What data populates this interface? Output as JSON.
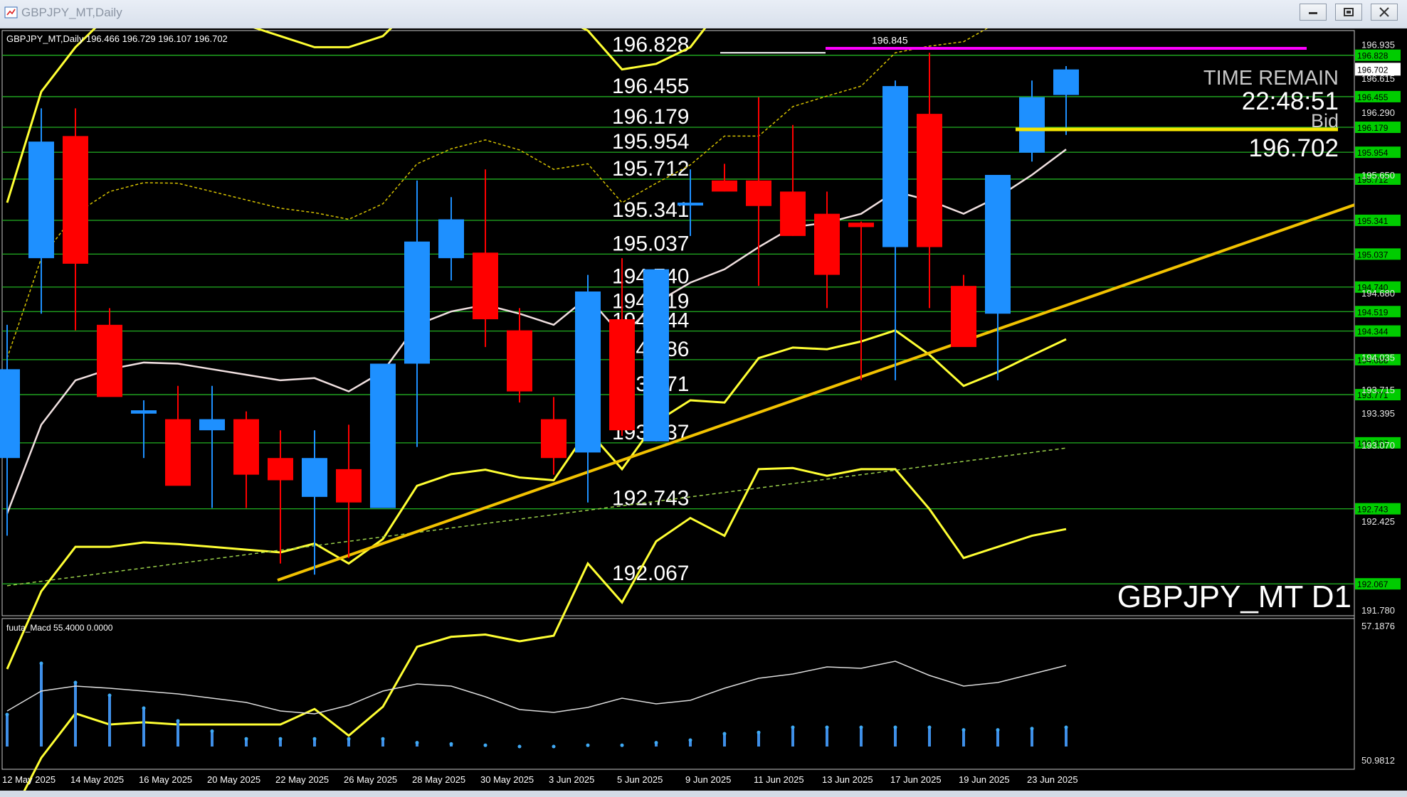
{
  "window": {
    "title": "GBPJPY_MT,Daily"
  },
  "chart_info": {
    "header": "GBPJPY_MT,Daily  196.466 196.729 196.107 196.702",
    "symbol_label": "GBPJPY_MT D1",
    "time_remain_label": "TIME REMAIN",
    "time_remain_value": "22:48:51",
    "bid_label": "Bid",
    "bid_value": "196.702",
    "high_marker": "196.845",
    "indicator_label": "fuuta_Macd 55.4000  0.0000",
    "indicator_top": "57.1876",
    "indicator_bottom": "50.9812"
  },
  "levels": [
    "196.828",
    "196.455",
    "196.179",
    "195.954",
    "195.712",
    "195.341",
    "195.037",
    "194.740",
    "194.519",
    "194.344",
    "194.086",
    "193.771",
    "193.337",
    "192.743",
    "192.067"
  ],
  "price_scale": [
    "196.935",
    "196.615",
    "196.290",
    "195.650",
    "194.680",
    "194.035",
    "193.715",
    "193.395",
    "193.070",
    "192.425",
    "191.780"
  ],
  "current_price_tag": "196.702",
  "x_axis": [
    "12 May 2025",
    "14 May 2025",
    "16 May 2025",
    "20 May 2025",
    "22 May 2025",
    "26 May 2025",
    "28 May 2025",
    "30 May 2025",
    "3 Jun 2025",
    "5 Jun 2025",
    "9 Jun 2025",
    "11 Jun 2025",
    "13 Jun 2025",
    "17 Jun 2025",
    "19 Jun 2025",
    "23 Jun 2025"
  ],
  "colors": {
    "background": "#000000",
    "bull": "#1e90ff",
    "bear": "#ff0000",
    "level_line": "#22b022",
    "level_tag": "#00cc00",
    "bands": "#ffff33",
    "trendline": "#f2c200",
    "magenta": "#ff00ff"
  },
  "chart_data": {
    "type": "candlestick",
    "symbol": "GBPJPY_MT",
    "timeframe": "Daily",
    "ohlc": [
      [
        193.2,
        194.4,
        192.5,
        194.0
      ],
      [
        195.0,
        196.35,
        194.5,
        196.05
      ],
      [
        196.1,
        196.35,
        194.35,
        194.95
      ],
      [
        194.4,
        194.55,
        193.9,
        193.75
      ],
      [
        193.6,
        193.72,
        193.2,
        193.63
      ],
      [
        193.55,
        193.85,
        193.0,
        192.95
      ],
      [
        193.45,
        193.85,
        192.75,
        193.55
      ],
      [
        193.55,
        193.62,
        192.75,
        193.05
      ],
      [
        193.2,
        193.45,
        192.25,
        193.0
      ],
      [
        192.85,
        193.45,
        192.15,
        193.2
      ],
      [
        193.1,
        193.5,
        192.3,
        192.8
      ],
      [
        192.75,
        193.9,
        192.75,
        194.05
      ],
      [
        194.05,
        195.7,
        193.3,
        195.15
      ],
      [
        195.0,
        195.55,
        194.8,
        195.35
      ],
      [
        195.05,
        195.8,
        194.2,
        194.45
      ],
      [
        194.35,
        194.55,
        193.7,
        193.8
      ],
      [
        193.55,
        193.75,
        193.05,
        193.2
      ],
      [
        193.25,
        194.85,
        192.8,
        194.7
      ],
      [
        194.45,
        195.0,
        193.4,
        193.45
      ],
      [
        193.35,
        194.9,
        193.35,
        194.9
      ],
      [
        195.5,
        195.8,
        195.2,
        195.5
      ],
      [
        195.7,
        195.85,
        195.6,
        195.6
      ],
      [
        195.7,
        196.45,
        194.75,
        195.47
      ],
      [
        195.6,
        196.2,
        195.2,
        195.2
      ],
      [
        195.4,
        195.6,
        194.55,
        194.85
      ],
      [
        195.32,
        195.33,
        193.9,
        195.28
      ],
      [
        195.1,
        196.6,
        193.9,
        196.55
      ],
      [
        196.3,
        196.85,
        194.55,
        195.1
      ],
      [
        194.75,
        194.85,
        194.35,
        194.2
      ],
      [
        194.5,
        195.65,
        193.9,
        195.75
      ],
      [
        195.95,
        196.6,
        195.87,
        196.45
      ],
      [
        196.47,
        196.73,
        196.11,
        196.7
      ]
    ],
    "levels": [
      196.828,
      196.455,
      196.179,
      195.954,
      195.712,
      195.341,
      195.037,
      194.74,
      194.519,
      194.344,
      194.086,
      193.771,
      193.337,
      192.743,
      192.067
    ],
    "ylim": [
      191.78,
      197.05
    ],
    "current": {
      "open": 196.466,
      "high": 196.729,
      "low": 196.107,
      "close": 196.702
    },
    "indicator": {
      "name": "fuuta_Macd",
      "values": [
        2.5,
        6.5,
        5.0,
        4.0,
        3.0,
        2.0,
        1.2,
        0.6,
        0.6,
        0.6,
        0.6,
        0.6,
        0.3,
        0.2,
        0.1,
        -0.1,
        -0.1,
        0.1,
        0.1,
        0.3,
        0.5,
        1.0,
        1.1,
        1.5,
        1.5,
        1.5,
        1.5,
        1.5,
        1.3,
        1.3,
        1.4,
        1.5
      ]
    }
  }
}
